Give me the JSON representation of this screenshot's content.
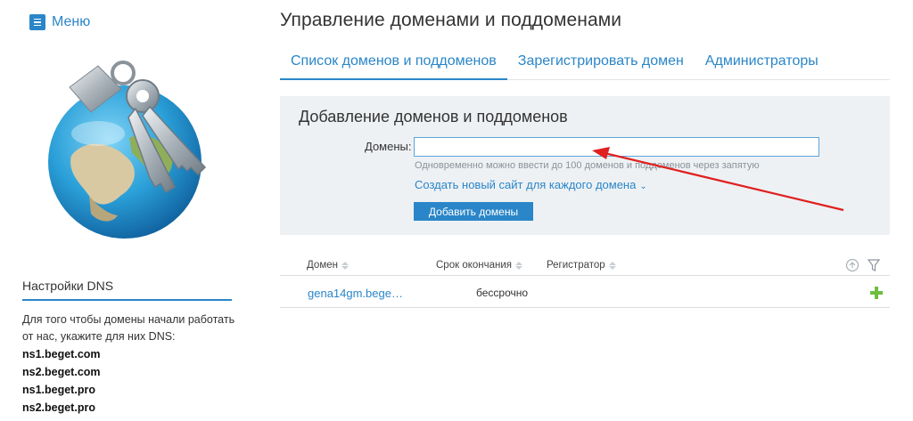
{
  "sidebar": {
    "menu_label": "Меню",
    "dns_title": "Настройки DNS",
    "dns_description": "Для того чтобы домены начали работать от нас, укажите для них DNS:",
    "dns_servers": [
      "ns1.beget.com",
      "ns2.beget.com",
      "ns1.beget.pro",
      "ns2.beget.pro"
    ]
  },
  "header": {
    "title": "Управление доменами и поддоменами"
  },
  "tabs": [
    {
      "label": "Список доменов и поддоменов",
      "active": true
    },
    {
      "label": "Зарегистрировать домен",
      "active": false
    },
    {
      "label": "Администраторы",
      "active": false
    }
  ],
  "add_panel": {
    "title": "Добавление доменов и поддоменов",
    "field_label": "Домены:",
    "input_value": "",
    "hint": "Одновременно можно ввести до 100 доменов и поддоменов через запятую",
    "create_site_label": "Создать новый сайт для каждого домена",
    "submit_label": "Добавить домены"
  },
  "table": {
    "columns": [
      "Домен",
      "Срок окончания",
      "Регистратор"
    ],
    "rows": [
      {
        "domain": "gena14gm.bege…",
        "expiration": "бессрочно",
        "registrar": ""
      }
    ]
  },
  "icons": {
    "menu": "hamburger-icon",
    "globe": "globe-with-keys-illustration",
    "refresh": "refresh-icon",
    "filter": "filter-icon",
    "add": "plus-icon",
    "chevron": "chevron-down-icon"
  },
  "colors": {
    "accent": "#2a86c8",
    "panel_bg": "#eef1f4",
    "add_green": "#6cbf3e",
    "annotation_red": "#e02020"
  }
}
